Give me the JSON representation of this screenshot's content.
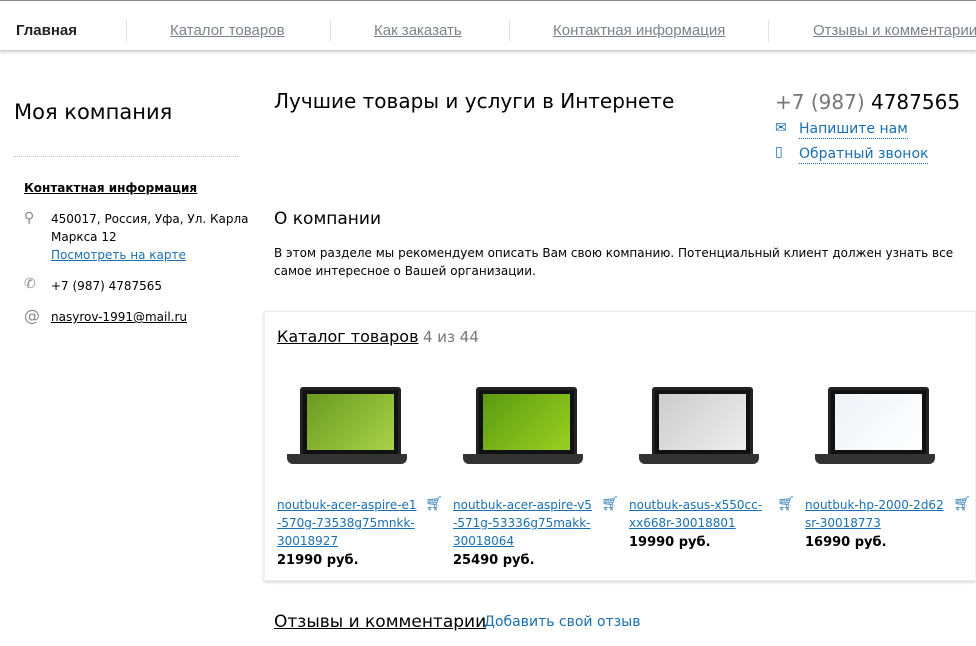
{
  "nav": [
    "Главная",
    "Каталог товаров",
    "Как заказать",
    "Контактная информация",
    "Отзывы и комментарии"
  ],
  "sidebar": {
    "company": "Моя компания",
    "contacts_title": "Контактная информация",
    "address1": "450017, Россия, Уфа, Ул. Карла",
    "address2": "Маркса 12",
    "map_link": "Посмотреть на карте",
    "phone": "+7 (987) 4787565",
    "email": "nasyrov-1991@mail.ru"
  },
  "header": {
    "title": "Лучшие товары и услуги в Интернете",
    "phone_code": "+7 (987)",
    "phone_number": "4787565",
    "write_us": "Напишите нам",
    "callback": "Обратный звонок"
  },
  "about": {
    "title": "О компании",
    "text": "В этом разделе мы рекомендуем описать Вам свою компанию. Потенциальный клиент должен узнать все самое интересное о Вашей организации."
  },
  "catalog": {
    "title": "Каталог товаров",
    "count": "4 из 44",
    "products": [
      {
        "name": "noutbuk-acer-aspire-e1-570g-73538g75mnkk-30018927",
        "price": "21990 руб."
      },
      {
        "name": "noutbuk-acer-aspire-v5-571g-53336g75makk-30018064",
        "price": "25490 руб."
      },
      {
        "name": "noutbuk-asus-x550cc-xx668r-30018801",
        "price": "19990 руб."
      },
      {
        "name": "noutbuk-hp-2000-2d62sr-30018773",
        "price": "16990 руб."
      }
    ]
  },
  "reviews": {
    "title": "Отзывы и комментарии",
    "add": "Добавить свой отзыв"
  }
}
